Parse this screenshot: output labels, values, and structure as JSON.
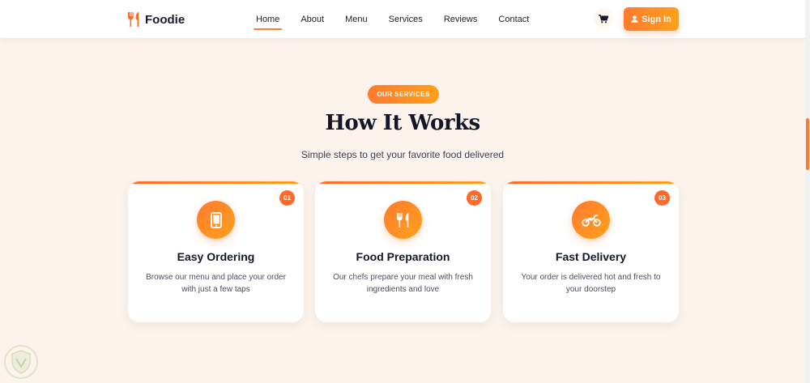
{
  "brand": {
    "name": "Foodie",
    "accent": "#ff7a2f",
    "accent_end": "#ffa11a"
  },
  "nav": {
    "links": [
      {
        "label": "Home",
        "active": true
      },
      {
        "label": "About"
      },
      {
        "label": "Menu"
      },
      {
        "label": "Services"
      },
      {
        "label": "Reviews"
      },
      {
        "label": "Contact"
      }
    ],
    "cart_icon": "cart-icon",
    "signin_label": "Sign In",
    "signin_icon": "user-icon"
  },
  "section": {
    "badge": "OUR SERVICES",
    "title": "How It Works",
    "subtitle": "Simple steps to get your favorite food delivered"
  },
  "cards": [
    {
      "number": "01",
      "icon": "smartphone-icon",
      "title": "Easy Ordering",
      "description": "Browse our menu and place your order with just a few taps"
    },
    {
      "number": "02",
      "icon": "utensils-icon",
      "title": "Food Preparation",
      "description": "Our chefs prepare your meal with fresh ingredients and love"
    },
    {
      "number": "03",
      "icon": "motorcycle-icon",
      "title": "Fast Delivery",
      "description": "Your order is delivered hot and fresh to your doorstep"
    }
  ]
}
